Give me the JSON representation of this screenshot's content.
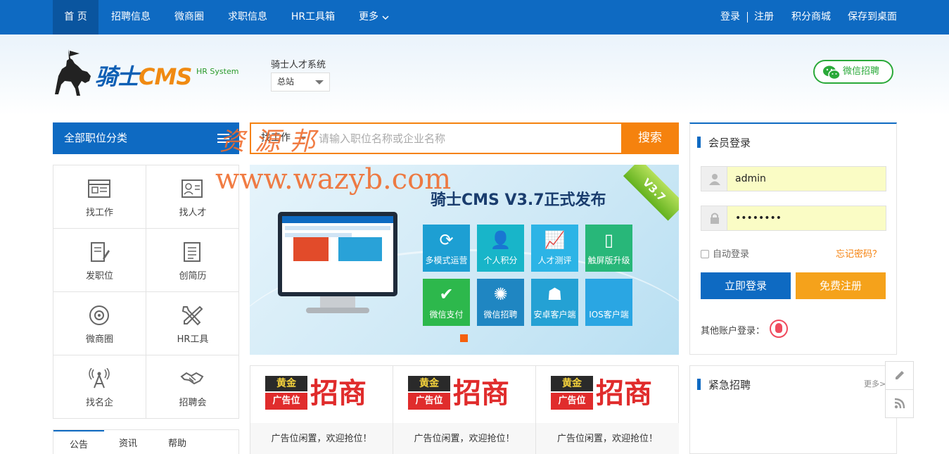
{
  "topnav": {
    "items": [
      "首 页",
      "招聘信息",
      "微商圈",
      "求职信息",
      "HR工具箱",
      "更多"
    ],
    "right": {
      "login": "登录",
      "separator": "|",
      "register": "注册",
      "points_mall": "积分商城",
      "save_desktop": "保存到桌面"
    }
  },
  "header": {
    "logo_text_1": "骑士",
    "logo_text_2": "CMS",
    "logo_sub": "HR System",
    "system_name": "骑士人才系统",
    "site_select_value": "总站",
    "wechat_button": "微信招聘"
  },
  "category": {
    "head": "全部职位分类",
    "cells": [
      {
        "label": "找工作",
        "icon": "job-search-icon"
      },
      {
        "label": "找人才",
        "icon": "talent-search-icon"
      },
      {
        "label": "发职位",
        "icon": "post-job-icon"
      },
      {
        "label": "创简历",
        "icon": "create-resume-icon"
      },
      {
        "label": "微商圈",
        "icon": "business-circle-icon"
      },
      {
        "label": "HR工具",
        "icon": "hr-tools-icon"
      },
      {
        "label": "找名企",
        "icon": "famous-company-icon"
      },
      {
        "label": "招聘会",
        "icon": "job-fair-icon"
      }
    ]
  },
  "notice": {
    "tabs": [
      "公告",
      "资讯",
      "帮助"
    ]
  },
  "search": {
    "type": "找工作",
    "placeholder": "请输入职位名称或企业名称",
    "button": "搜索"
  },
  "watermark": {
    "line1": "资源邦",
    "line2": "www.wazyb.com"
  },
  "banner": {
    "title": "骑士CMS V3.7正式发布",
    "ribbon": "V3.7",
    "tiles": [
      {
        "label": "多模式运营",
        "icon": "refresh-icon",
        "color": "#1d9fd3"
      },
      {
        "label": "个人积分",
        "icon": "user-plus-icon",
        "color": "#18b5c9"
      },
      {
        "label": "人才测评",
        "icon": "chart-icon",
        "color": "#2cb4e6"
      },
      {
        "label": "触屏版升级",
        "icon": "mobile-icon",
        "color": "#28b779"
      },
      {
        "label": "微信支付",
        "icon": "wechat-pay-icon",
        "color": "#2db84c"
      },
      {
        "label": "微信招聘",
        "icon": "shutter-icon",
        "color": "#1f86c2"
      },
      {
        "label": "安卓客户端",
        "icon": "android-icon",
        "color": "#24a1d4"
      },
      {
        "label": "IOS客户端",
        "icon": "apple-icon",
        "color": "#2aa6e3"
      }
    ]
  },
  "ads": {
    "items": [
      {
        "badge_1": "黄金",
        "badge_2": "广告位",
        "big": "招商",
        "caption": "广告位闲置，欢迎抢位！"
      },
      {
        "badge_1": "黄金",
        "badge_2": "广告位",
        "big": "招商",
        "caption": "广告位闲置，欢迎抢位！"
      },
      {
        "badge_1": "黄金",
        "badge_2": "广告位",
        "big": "招商",
        "caption": "广告位闲置，欢迎抢位！"
      }
    ]
  },
  "login": {
    "title": "会员登录",
    "username": "admin",
    "password": "••••••••",
    "auto_login": "自动登录",
    "forgot": "忘记密码？",
    "login_button": "立即登录",
    "register_button": "免费注册",
    "other_login": "其他账户登录："
  },
  "urgent": {
    "title": "紧急招聘",
    "more": "更多>"
  },
  "colors": {
    "primary": "#0e6ac2",
    "accent": "#f5820e",
    "wechat": "#2aa939"
  }
}
